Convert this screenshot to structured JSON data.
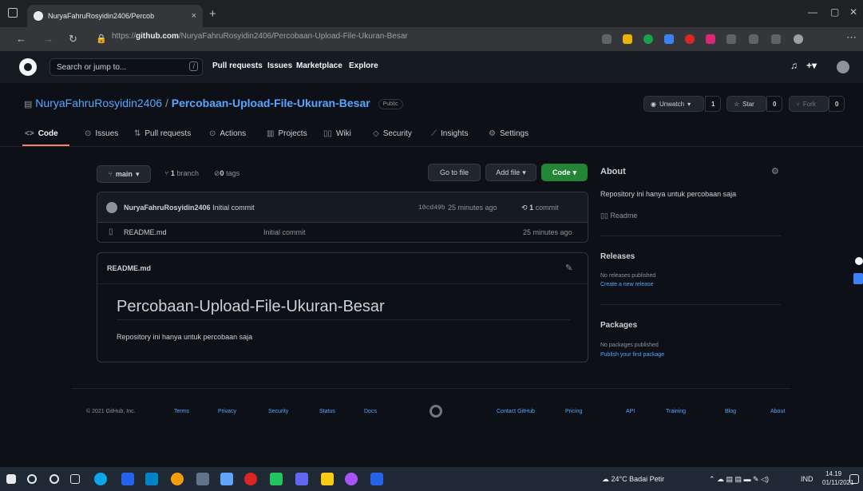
{
  "browser": {
    "tab_title": "NuryaFahruRosyidin2406/Percob",
    "tab_close": "×",
    "new_tab": "+",
    "url_prefix": "https://",
    "url_domain": "github.com",
    "url_path": "/NuryaFahruRosyidin2406/Percobaan-Upload-File-Ukuran-Besar"
  },
  "header": {
    "search_placeholder": "Search or jump to...",
    "slash_key": "/",
    "nav": [
      "Pull requests",
      "Issues",
      "Marketplace",
      "Explore"
    ]
  },
  "repo": {
    "owner": "NuryaFahruRosyidin2406",
    "separator": " / ",
    "name": "Percobaan-Upload-File-Ukuran-Besar",
    "visibility": "Public",
    "unwatch_label": "Unwatch",
    "watch_count": "1",
    "star_label": "Star",
    "star_count": "0",
    "fork_label": "Fork",
    "fork_count": "0",
    "tabs": [
      "Code",
      "Issues",
      "Pull requests",
      "Actions",
      "Projects",
      "Wiki",
      "Security",
      "Insights",
      "Settings"
    ]
  },
  "filebrowser": {
    "branch": "main",
    "branch_count": "1",
    "branch_label": "branch",
    "tag_count": "0",
    "tag_label": "tags",
    "go_to_file": "Go to file",
    "add_file": "Add file",
    "code": "Code",
    "commit_author": "NuryaFahruRosyidin2406",
    "commit_message": "Initial commit",
    "commit_hash": "10cd49b",
    "commit_time": "25 minutes ago",
    "commit_count": "1",
    "commit_label": "commit",
    "files": [
      {
        "name": "README.md",
        "message": "Initial commit",
        "time": "25 minutes ago"
      }
    ]
  },
  "readme": {
    "filename": "README.md",
    "heading": "Percobaan-Upload-File-Ukuran-Besar",
    "body": "Repository ini hanya untuk percobaan saja"
  },
  "sidebar": {
    "about_title": "About",
    "about_text": "Repository ini hanya untuk percobaan saja",
    "readme_label": "Readme",
    "releases_title": "Releases",
    "releases_text": "No releases published",
    "releases_link": "Create a new release",
    "packages_title": "Packages",
    "packages_text": "No packages published",
    "packages_link": "Publish your first package"
  },
  "footer": {
    "copyright": "© 2021 GitHub, Inc.",
    "links_left": [
      "Terms",
      "Privacy",
      "Security",
      "Status",
      "Docs"
    ],
    "links_right": [
      "Contact GitHub",
      "Pricing",
      "API",
      "Training",
      "Blog",
      "About"
    ]
  },
  "taskbar": {
    "weather": "24°C  Badai Petir",
    "language": "IND",
    "time": "14.19",
    "date": "01/11/2021"
  },
  "colors": {
    "accent": "#58a6ff",
    "green": "#238636",
    "background": "#0d1117"
  }
}
